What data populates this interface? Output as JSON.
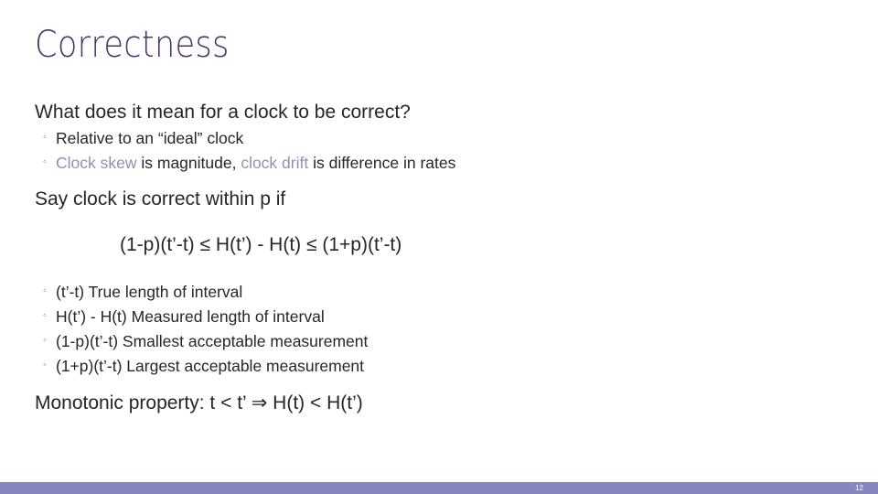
{
  "slide": {
    "title": "Correctness",
    "question": "What does it mean for a clock to be correct?",
    "sub_bullets_1": [
      {
        "parts": [
          {
            "text": "Relative to an “ideal” clock",
            "highlight": false
          }
        ]
      },
      {
        "parts": [
          {
            "text": "Clock skew",
            "highlight": true
          },
          {
            "text": " is magnitude, ",
            "highlight": false
          },
          {
            "text": "clock drift",
            "highlight": true
          },
          {
            "text": " is difference in rates",
            "highlight": false
          }
        ]
      }
    ],
    "statement": "Say clock is correct within p if",
    "formula": "(1-p)(t’-t) ≤ H(t’) - H(t) ≤ (1+p)(t’-t)",
    "sub_bullets_2": [
      "(t’-t)  True length of interval",
      "H(t’) - H(t)  Measured length of interval",
      "(1-p)(t’-t)  Smallest acceptable measurement",
      "(1+p)(t’-t)  Largest acceptable measurement"
    ],
    "monotonic": "Monotonic property:  t < t’  ⇒ H(t) < H(t’)",
    "bullet_glyph": "◦",
    "page_number": "12"
  },
  "colors": {
    "title": "#4b3466",
    "highlight": "#9c8ab0",
    "footer": "#8585c0"
  }
}
